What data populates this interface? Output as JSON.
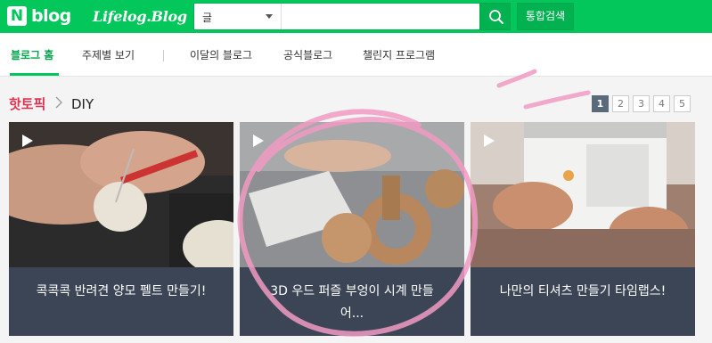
{
  "header": {
    "logo_mark": "N",
    "logo_text": "blog",
    "logo_sub": "Lifelog.Blog",
    "search_select": "글",
    "search_placeholder": "",
    "search_icon": "search-icon",
    "total_search_label": "통합검색",
    "brand_color": "#03c75a"
  },
  "nav": {
    "items": [
      {
        "label": "블로그 홈"
      },
      {
        "label": "주제별 보기"
      },
      {
        "label": "이달의 블로그"
      },
      {
        "label": "공식블로그"
      },
      {
        "label": "챌린지 프로그램"
      }
    ]
  },
  "breadcrumb": {
    "topic": "핫토픽",
    "category": "DIY"
  },
  "pager": {
    "pages": [
      "1",
      "2",
      "3",
      "4",
      "5"
    ],
    "current": "1"
  },
  "cards": [
    {
      "title": "콕콕콕 반려견 양모 펠트 만들기!",
      "play_icon": "play-icon"
    },
    {
      "title": "3D 우드 퍼즐 부엉이 시계 만들어...",
      "play_icon": "play-icon"
    },
    {
      "title": "나만의 티셔츠 만들기 타임랩스!",
      "play_icon": "play-icon"
    }
  ]
}
